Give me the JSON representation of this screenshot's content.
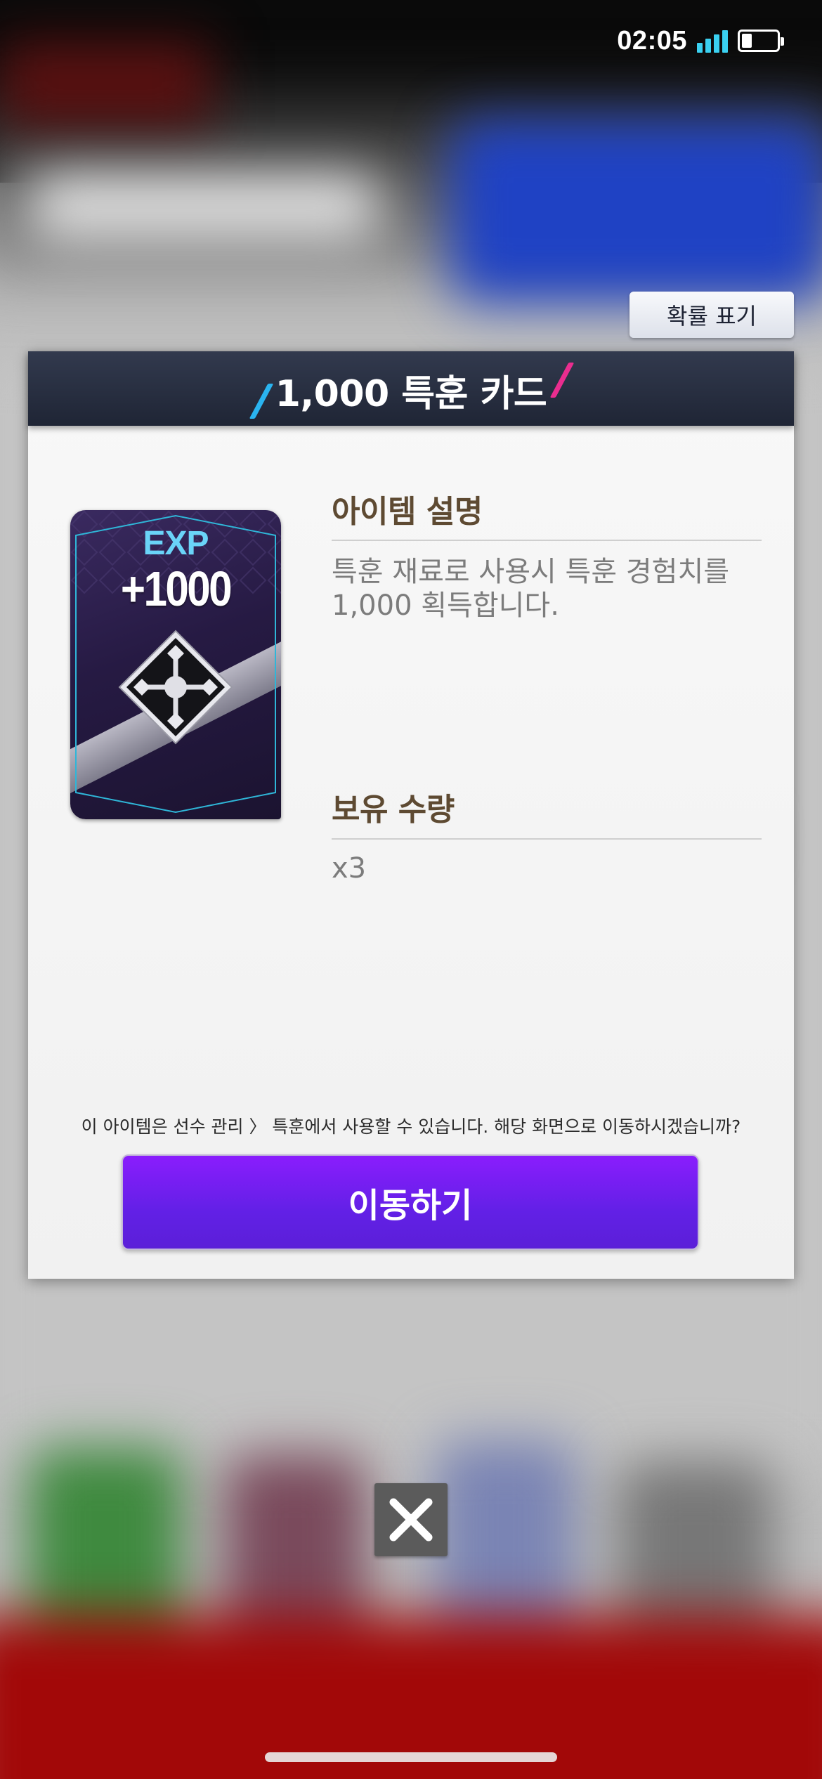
{
  "status_bar": {
    "time": "02:05",
    "signal_icon": "signal-bars-icon",
    "battery_icon": "battery-icon"
  },
  "probability_button": {
    "label": "확률 표기"
  },
  "modal": {
    "title": "1,000 특훈 카드",
    "card": {
      "exp_label": "EXP",
      "exp_value": "+1000",
      "emblem_icon": "training-emblem-icon"
    },
    "description": {
      "heading": "아이템 설명",
      "text": "특훈 재료로 사용시 특훈 경험치를 1,000 획득합니다."
    },
    "owned": {
      "heading": "보유 수량",
      "value": "x3"
    },
    "notice": "이 아이템은 선수 관리 〉 특훈에서 사용할 수 있습니다. 해당 화면으로 이동하시겠습니까?",
    "go_button": {
      "label": "이동하기"
    }
  },
  "close_button": {
    "icon": "close-icon"
  },
  "colors": {
    "header_bg": "#262c3e",
    "accent_purple": "#7a1ef8",
    "section_heading": "#5e4a32",
    "slash_blue": "#2ab4f0",
    "slash_pink": "#ea2d8f",
    "card_exp": "#6ad4f8"
  }
}
